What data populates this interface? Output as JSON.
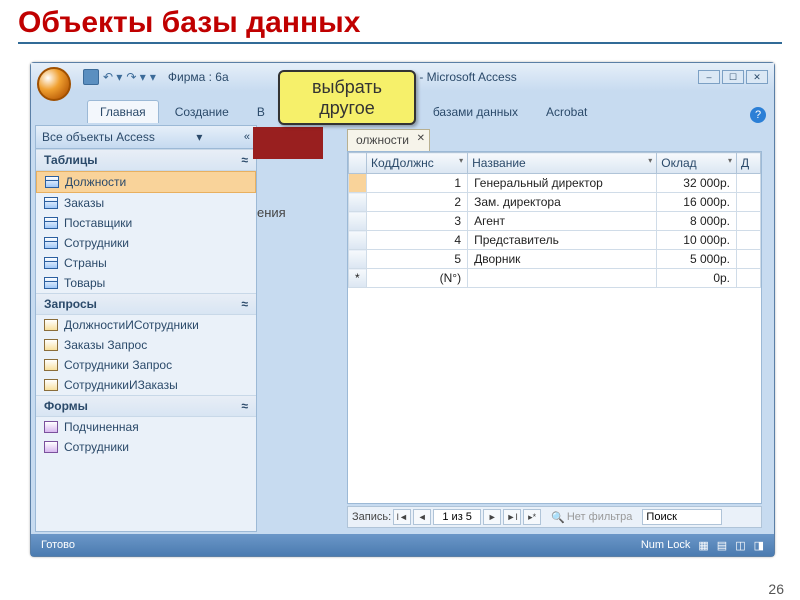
{
  "slide": {
    "title": "Объекты базы данных",
    "page": "26"
  },
  "callout": {
    "line1": "выбрать",
    "line2": "другое"
  },
  "window": {
    "title_left": "Фирма : 6а",
    "title_right": "00) - Microsoft Access",
    "tabs": [
      "Главная",
      "Создание",
      "В",
      "базами данных",
      "Acrobat"
    ],
    "help": "?"
  },
  "nav": {
    "header": "Все объекты Access",
    "groups": {
      "tables": {
        "label": "Таблицы",
        "items": [
          "Должности",
          "Заказы",
          "Поставщики",
          "Сотрудники",
          "Страны",
          "Товары"
        ]
      },
      "queries": {
        "label": "Запросы",
        "items": [
          "ДолжностиИСотрудники",
          "Заказы Запрос",
          "Сотрудники Запрос",
          "СотрудникиИЗаказы"
        ]
      },
      "forms": {
        "label": "Формы",
        "items": [
          "Подчиненная",
          "Сотрудники"
        ]
      }
    }
  },
  "overlay_text": "ения",
  "doc": {
    "tab": "олжности",
    "columns": [
      "КодДолжнс",
      "Название",
      "Оклад",
      "Д"
    ],
    "rows": [
      {
        "id": "1",
        "name": "Генеральный директор",
        "salary": "32 000р."
      },
      {
        "id": "2",
        "name": "Зам. директора",
        "salary": "16 000р."
      },
      {
        "id": "3",
        "name": "Агент",
        "salary": "8 000р."
      },
      {
        "id": "4",
        "name": "Представитель",
        "salary": "10 000р."
      },
      {
        "id": "5",
        "name": "Дворник",
        "salary": "5 000р."
      }
    ],
    "newrow": {
      "id": "(N°)",
      "salary": "0р."
    },
    "recnav": {
      "label": "Запись:",
      "pos": "1 из 5",
      "filter": "Нет фильтра",
      "search": "Поиск"
    }
  },
  "status": {
    "left": "Готово",
    "numlock": "Num Lock"
  }
}
